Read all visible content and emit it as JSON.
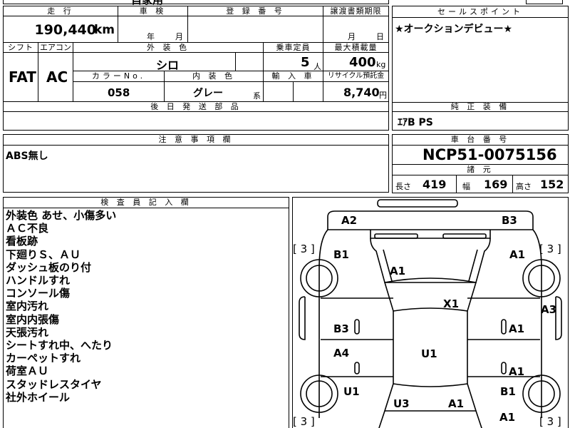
{
  "top_row": {
    "cut_text": "自家用"
  },
  "mileage": {
    "header": "走 行",
    "value": "190,440",
    "unit": "km"
  },
  "inspection": {
    "header": "車 検",
    "year_unit": "年",
    "month_unit": "月"
  },
  "registration": {
    "header": "登 録 番 号"
  },
  "transfer": {
    "header": "譲渡書類期限",
    "month_unit": "月",
    "day_unit": "日"
  },
  "sales_point": {
    "header": "セールスポイント",
    "text": "★オークションデビュー★"
  },
  "shift": {
    "header": "シフト",
    "value": "FAT"
  },
  "aircon": {
    "header": "エアコン",
    "value": "AC"
  },
  "exterior_color": {
    "header": "外 装 色",
    "value": "シロ"
  },
  "capacity": {
    "header": "乗車定員",
    "value": "5",
    "unit": "人"
  },
  "max_load": {
    "header": "最大積載量",
    "value": "400",
    "unit": "kg"
  },
  "color_no": {
    "header": "カラーNo.",
    "value": "058"
  },
  "interior_color": {
    "header": "内 装 色",
    "value": "グレー",
    "unit": "系"
  },
  "import": {
    "header": "輸 入 車"
  },
  "recycle": {
    "header": "リサイクル預託金",
    "value": "8,740",
    "unit": "円"
  },
  "later_parts": {
    "header": "後 日 発 送 部 品"
  },
  "genuine": {
    "header": "純 正 装 備",
    "text": "ｴｱB PS"
  },
  "notes": {
    "header": "注 意 事 項 欄",
    "text": "ABS無し"
  },
  "chassis": {
    "header": "車 台 番 号",
    "value": "NCP51-0075156"
  },
  "specs": {
    "header": "諸 元",
    "length_label": "長さ",
    "length": "419",
    "width_label": "幅",
    "width": "169",
    "height_label": "高さ",
    "height": "152"
  },
  "inspector": {
    "header": "検 査 員 記 入 欄",
    "lines": [
      "外装色 あせ、小傷多い",
      "ＡＣ不良",
      "看板跡",
      "下廻りＳ、ＡＵ",
      "ダッシュ板のり付",
      "ハンドルすれ",
      "コンソール傷",
      "室内汚れ",
      "室内内張傷",
      "天張汚れ",
      "シートすれ中、へたり",
      "カーペットすれ",
      "荷室ＡＵ",
      "スタッドレスタイヤ",
      "社外ホイール"
    ]
  },
  "diagram": {
    "tire_brackets": [
      "[ 3 ]",
      "[ 3 ]",
      "[ 3 ]",
      "[ 3 ]"
    ],
    "marks": {
      "front_left_corner": "A2",
      "front_right_corner": "B3",
      "left_front_fender": "B1",
      "hood": "A1",
      "right_front_fender": "A1",
      "right_edge": "A3",
      "roof_front": "X1",
      "left_front_door": "B3",
      "right_front_door": "A1",
      "left_rear_door": "A4",
      "roof": "U1",
      "right_rear_door": "A1",
      "left_rear_fender": "U1",
      "right_rear_fender": "B1",
      "trunk_left": "U3",
      "trunk_right": "A1",
      "rear_right": "A1"
    }
  }
}
